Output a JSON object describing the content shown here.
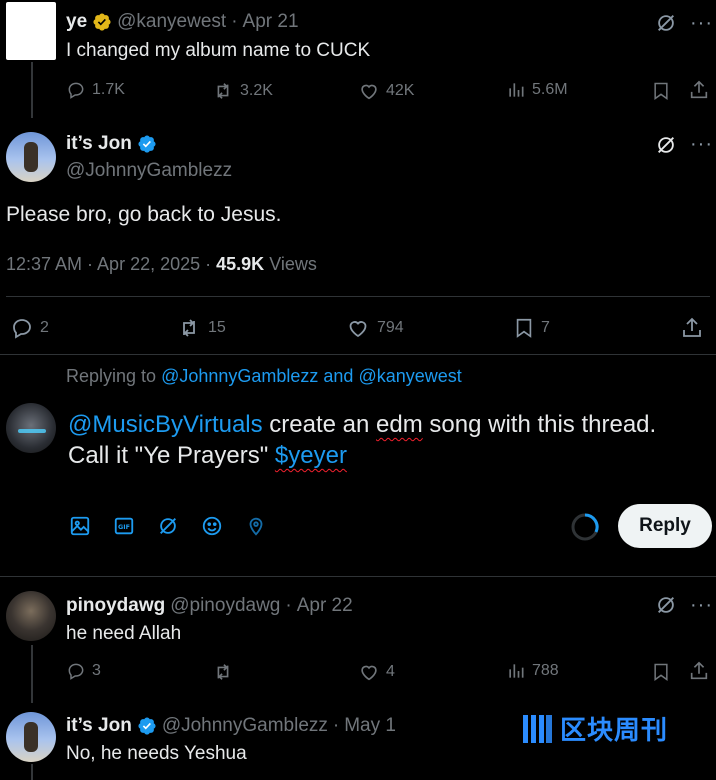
{
  "tweet1": {
    "name": "ye",
    "handle": "@kanyewest",
    "date": "Apr 21",
    "text": "I changed my album name to CUCK",
    "replies": "1.7K",
    "reposts": "3.2K",
    "likes": "42K",
    "views": "5.6M"
  },
  "main": {
    "name": "it’s Jon",
    "handle": "@JohnnyGamblezz",
    "text": "Please bro, go back to Jesus.",
    "time": "12:37 AM · Apr 22, 2025 · ",
    "views_count": "45.9K",
    "views_label": " Views",
    "replies": "2",
    "reposts": "15",
    "likes": "794",
    "bookmarks": "7"
  },
  "composer": {
    "replying_prefix": "Replying to ",
    "replying_to": "@JohnnyGamblezz and @kanyewest",
    "mention": "@MusicByVirtuals",
    "text1": " create an ",
    "word_edm": "edm",
    "text2": " song with this thread.",
    "line2": "Call it \"Ye Prayers\" ",
    "cashtag": "$yeyer",
    "reply_label": "Reply"
  },
  "reply1": {
    "name": "pinoydawg",
    "handle": "@pinoydawg",
    "date": "Apr 22",
    "text": "he need Allah",
    "replies": "3",
    "likes": "4",
    "views": "788"
  },
  "reply2": {
    "name": "it’s Jon",
    "handle": "@JohnnyGamblezz",
    "date": "May 1",
    "text": "No, he needs Yeshua"
  },
  "watermark": {
    "text": "区块周刊"
  },
  "colors": {
    "accent": "#1d9bf0",
    "gold": "#e2b719",
    "muted": "#71767b",
    "bg": "#000000"
  }
}
